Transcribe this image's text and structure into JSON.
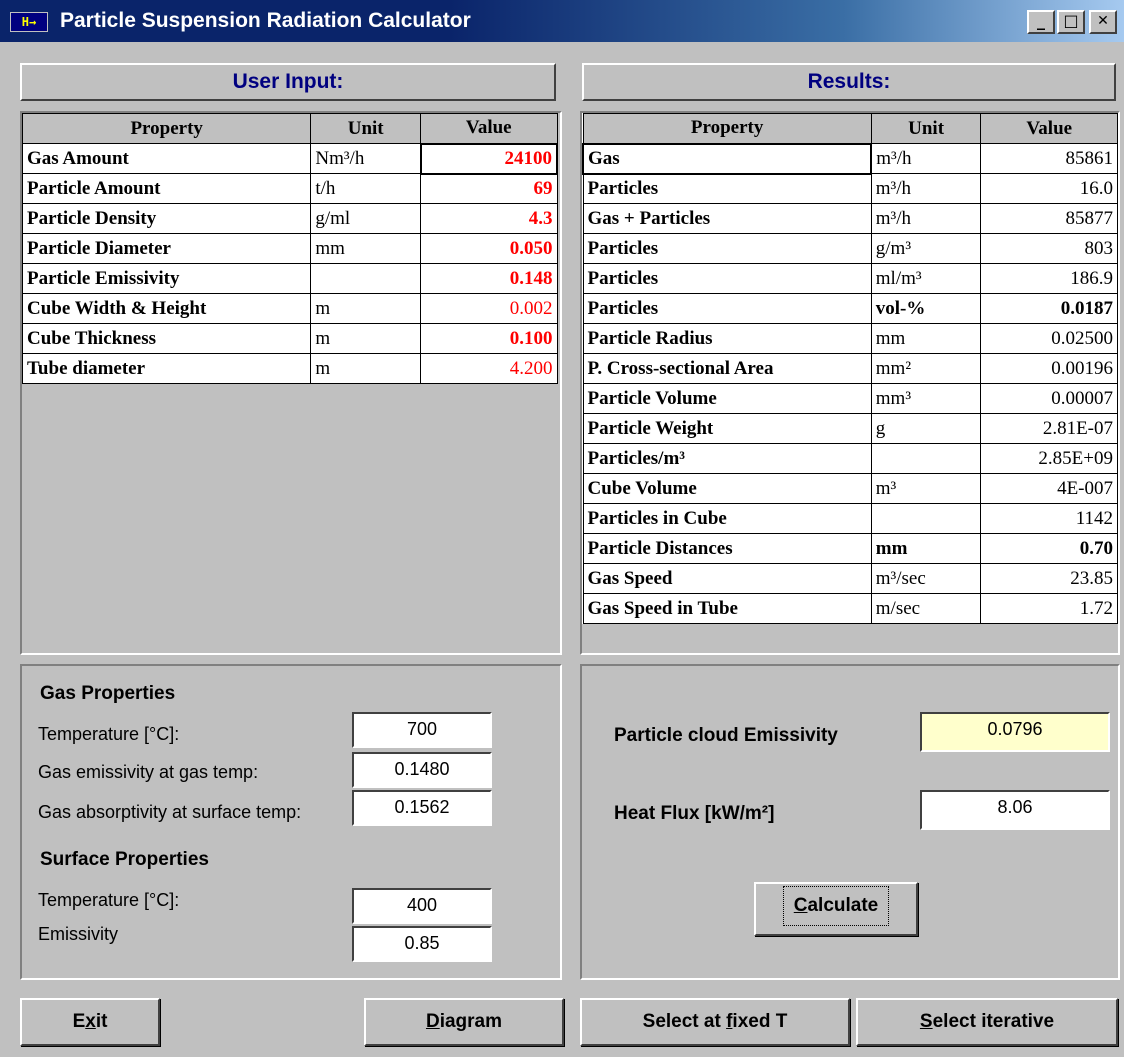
{
  "window": {
    "title": "Particle Suspension Radiation Calculator",
    "icon_text": "H→",
    "minimize": "_",
    "maximize": "□",
    "close": "✕"
  },
  "input_panel": {
    "header": "User Input:",
    "columns": [
      "Property",
      "Unit",
      "Value"
    ],
    "rows": [
      {
        "property": "Gas Amount",
        "unit": "Nm³/h",
        "value": "24100"
      },
      {
        "property": "Particle Amount",
        "unit": "t/h",
        "value": "69"
      },
      {
        "property": "Particle Density",
        "unit": "g/ml",
        "value": "4.3"
      },
      {
        "property": "Particle Diameter",
        "unit": "mm",
        "value": "0.050"
      },
      {
        "property": "Particle Emissivity",
        "unit": "",
        "value": "0.148"
      },
      {
        "property": "Cube Width & Height",
        "unit": "m",
        "value": "0.002"
      },
      {
        "property": "Cube Thickness",
        "unit": "m",
        "value": "0.100"
      },
      {
        "property": "Tube diameter",
        "unit": "m",
        "value": "4.200"
      }
    ]
  },
  "results_panel": {
    "header": "Results:",
    "columns": [
      "Property",
      "Unit",
      "Value"
    ],
    "rows": [
      {
        "property": "Gas",
        "unit": "m³/h",
        "value": "85861"
      },
      {
        "property": "Particles",
        "unit": "m³/h",
        "value": "16.0"
      },
      {
        "property": "Gas + Particles",
        "unit": "m³/h",
        "value": "85877"
      },
      {
        "property": "Particles",
        "unit": "g/m³",
        "value": "803"
      },
      {
        "property": "Particles",
        "unit": "ml/m³",
        "value": "186.9"
      },
      {
        "property": "Particles",
        "unit": "vol-%",
        "value": "0.0187"
      },
      {
        "property": "Particle Radius",
        "unit": "mm",
        "value": "0.02500"
      },
      {
        "property": "P. Cross-sectional Area",
        "unit": "mm²",
        "value": "0.00196"
      },
      {
        "property": "Particle Volume",
        "unit": "mm³",
        "value": "0.00007"
      },
      {
        "property": "Particle Weight",
        "unit": "g",
        "value": "2.81E-07"
      },
      {
        "property": "Particles/m³",
        "unit": "",
        "value": "2.85E+09"
      },
      {
        "property": "Cube Volume",
        "unit": "m³",
        "value": "4E-007"
      },
      {
        "property": "Particles in Cube",
        "unit": "",
        "value": "1142"
      },
      {
        "property": "Particle Distances",
        "unit": "mm",
        "value": "0.70"
      },
      {
        "property": "Gas Speed",
        "unit": "m³/sec",
        "value": "23.85"
      },
      {
        "property": "Gas Speed in Tube",
        "unit": "m/sec",
        "value": "1.72"
      }
    ]
  },
  "gas_properties": {
    "header": "Gas Properties",
    "temperature_label": "Temperature [°C]:",
    "temperature": "700",
    "emissivity_label": "Gas emissivity at gas temp:",
    "emissivity": "0.1480",
    "absorptivity_label": "Gas absorptivity at surface temp:",
    "absorptivity": "0.1562"
  },
  "surface_properties": {
    "header": "Surface Properties",
    "temperature_label": "Temperature [°C]:",
    "temperature": "400",
    "emissivity_label": "Emissivity",
    "emissivity": "0.85"
  },
  "output": {
    "cloud_emissivity_label": "Particle cloud Emissivity",
    "cloud_emissivity": "0.0796",
    "cloud_emissivity_bg": "#ffffcc",
    "heat_flux_label": "Heat Flux [kW/m²]",
    "heat_flux": "8.06"
  },
  "buttons": {
    "calculate_u": "C",
    "calculate_rest": "alculate",
    "exit_a": "E",
    "exit_u": "x",
    "exit_b": "it",
    "diagram_u": "D",
    "diagram_rest": "iagram",
    "fixed_a": "Select at ",
    "fixed_u": "f",
    "fixed_b": "ixed T",
    "iter_u": "S",
    "iter_rest": "elect iterative"
  }
}
